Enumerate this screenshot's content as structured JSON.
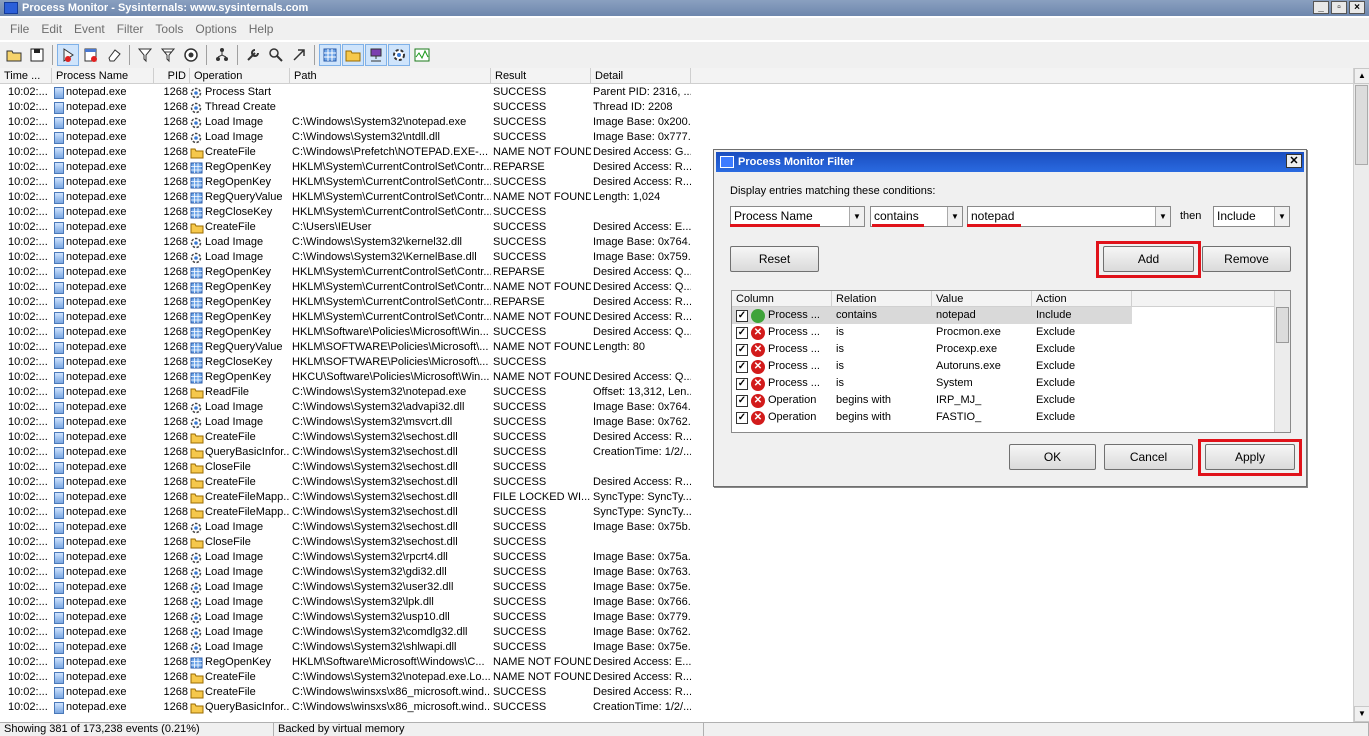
{
  "window": {
    "title": "Process Monitor - Sysinternals: www.sysinternals.com",
    "min_label": "_",
    "restore_label": "▫",
    "close_label": "×"
  },
  "menu": [
    "File",
    "Edit",
    "Event",
    "Filter",
    "Tools",
    "Options",
    "Help"
  ],
  "toolbar": {
    "icons": [
      "open-icon",
      "save-icon",
      "capture-icon",
      "autoscroll-icon",
      "clear-icon",
      "filter-icon",
      "highlight-icon",
      "include-process-icon",
      "process-tree-icon",
      "properties-icon",
      "find-icon",
      "jump-icon",
      "registry-activity-icon",
      "file-activity-icon",
      "network-activity-icon",
      "process-activity-icon",
      "profiling-activity-icon"
    ]
  },
  "columns": {
    "time": "Time ...",
    "process": "Process Name",
    "pid": "PID",
    "operation": "Operation",
    "path": "Path",
    "result": "Result",
    "detail": "Detail"
  },
  "events": [
    {
      "time": "10:02:...",
      "proc": "notepad.exe",
      "pid": "1268",
      "op": "Process Start",
      "kind": "proc",
      "path": "",
      "result": "SUCCESS",
      "detail": "Parent PID: 2316, ..."
    },
    {
      "time": "10:02:...",
      "proc": "notepad.exe",
      "pid": "1268",
      "op": "Thread Create",
      "kind": "proc",
      "path": "",
      "result": "SUCCESS",
      "detail": "Thread ID: 2208"
    },
    {
      "time": "10:02:...",
      "proc": "notepad.exe",
      "pid": "1268",
      "op": "Load Image",
      "kind": "proc",
      "path": "C:\\Windows\\System32\\notepad.exe",
      "result": "SUCCESS",
      "detail": "Image Base: 0x200..."
    },
    {
      "time": "10:02:...",
      "proc": "notepad.exe",
      "pid": "1268",
      "op": "Load Image",
      "kind": "proc",
      "path": "C:\\Windows\\System32\\ntdll.dll",
      "result": "SUCCESS",
      "detail": "Image Base: 0x777..."
    },
    {
      "time": "10:02:...",
      "proc": "notepad.exe",
      "pid": "1268",
      "op": "CreateFile",
      "kind": "file",
      "path": "C:\\Windows\\Prefetch\\NOTEPAD.EXE-...",
      "result": "NAME NOT FOUND",
      "detail": "Desired Access: G..."
    },
    {
      "time": "10:02:...",
      "proc": "notepad.exe",
      "pid": "1268",
      "op": "RegOpenKey",
      "kind": "reg",
      "path": "HKLM\\System\\CurrentControlSet\\Contr...",
      "result": "REPARSE",
      "detail": "Desired Access: R..."
    },
    {
      "time": "10:02:...",
      "proc": "notepad.exe",
      "pid": "1268",
      "op": "RegOpenKey",
      "kind": "reg",
      "path": "HKLM\\System\\CurrentControlSet\\Contr...",
      "result": "SUCCESS",
      "detail": "Desired Access: R..."
    },
    {
      "time": "10:02:...",
      "proc": "notepad.exe",
      "pid": "1268",
      "op": "RegQueryValue",
      "kind": "reg",
      "path": "HKLM\\System\\CurrentControlSet\\Contr...",
      "result": "NAME NOT FOUND",
      "detail": "Length: 1,024"
    },
    {
      "time": "10:02:...",
      "proc": "notepad.exe",
      "pid": "1268",
      "op": "RegCloseKey",
      "kind": "reg",
      "path": "HKLM\\System\\CurrentControlSet\\Contr...",
      "result": "SUCCESS",
      "detail": ""
    },
    {
      "time": "10:02:...",
      "proc": "notepad.exe",
      "pid": "1268",
      "op": "CreateFile",
      "kind": "file",
      "path": "C:\\Users\\IEUser",
      "result": "SUCCESS",
      "detail": "Desired Access: E..."
    },
    {
      "time": "10:02:...",
      "proc": "notepad.exe",
      "pid": "1268",
      "op": "Load Image",
      "kind": "proc",
      "path": "C:\\Windows\\System32\\kernel32.dll",
      "result": "SUCCESS",
      "detail": "Image Base: 0x764..."
    },
    {
      "time": "10:02:...",
      "proc": "notepad.exe",
      "pid": "1268",
      "op": "Load Image",
      "kind": "proc",
      "path": "C:\\Windows\\System32\\KernelBase.dll",
      "result": "SUCCESS",
      "detail": "Image Base: 0x759..."
    },
    {
      "time": "10:02:...",
      "proc": "notepad.exe",
      "pid": "1268",
      "op": "RegOpenKey",
      "kind": "reg",
      "path": "HKLM\\System\\CurrentControlSet\\Contr...",
      "result": "REPARSE",
      "detail": "Desired Access: Q..."
    },
    {
      "time": "10:02:...",
      "proc": "notepad.exe",
      "pid": "1268",
      "op": "RegOpenKey",
      "kind": "reg",
      "path": "HKLM\\System\\CurrentControlSet\\Contr...",
      "result": "NAME NOT FOUND",
      "detail": "Desired Access: Q..."
    },
    {
      "time": "10:02:...",
      "proc": "notepad.exe",
      "pid": "1268",
      "op": "RegOpenKey",
      "kind": "reg",
      "path": "HKLM\\System\\CurrentControlSet\\Contr...",
      "result": "REPARSE",
      "detail": "Desired Access: R..."
    },
    {
      "time": "10:02:...",
      "proc": "notepad.exe",
      "pid": "1268",
      "op": "RegOpenKey",
      "kind": "reg",
      "path": "HKLM\\System\\CurrentControlSet\\Contr...",
      "result": "NAME NOT FOUND",
      "detail": "Desired Access: R..."
    },
    {
      "time": "10:02:...",
      "proc": "notepad.exe",
      "pid": "1268",
      "op": "RegOpenKey",
      "kind": "reg",
      "path": "HKLM\\Software\\Policies\\Microsoft\\Win...",
      "result": "SUCCESS",
      "detail": "Desired Access: Q..."
    },
    {
      "time": "10:02:...",
      "proc": "notepad.exe",
      "pid": "1268",
      "op": "RegQueryValue",
      "kind": "reg",
      "path": "HKLM\\SOFTWARE\\Policies\\Microsoft\\...",
      "result": "NAME NOT FOUND",
      "detail": "Length: 80"
    },
    {
      "time": "10:02:...",
      "proc": "notepad.exe",
      "pid": "1268",
      "op": "RegCloseKey",
      "kind": "reg",
      "path": "HKLM\\SOFTWARE\\Policies\\Microsoft\\...",
      "result": "SUCCESS",
      "detail": ""
    },
    {
      "time": "10:02:...",
      "proc": "notepad.exe",
      "pid": "1268",
      "op": "RegOpenKey",
      "kind": "reg",
      "path": "HKCU\\Software\\Policies\\Microsoft\\Win...",
      "result": "NAME NOT FOUND",
      "detail": "Desired Access: Q..."
    },
    {
      "time": "10:02:...",
      "proc": "notepad.exe",
      "pid": "1268",
      "op": "ReadFile",
      "kind": "file",
      "path": "C:\\Windows\\System32\\notepad.exe",
      "result": "SUCCESS",
      "detail": "Offset: 13,312, Len..."
    },
    {
      "time": "10:02:...",
      "proc": "notepad.exe",
      "pid": "1268",
      "op": "Load Image",
      "kind": "proc",
      "path": "C:\\Windows\\System32\\advapi32.dll",
      "result": "SUCCESS",
      "detail": "Image Base: 0x764..."
    },
    {
      "time": "10:02:...",
      "proc": "notepad.exe",
      "pid": "1268",
      "op": "Load Image",
      "kind": "proc",
      "path": "C:\\Windows\\System32\\msvcrt.dll",
      "result": "SUCCESS",
      "detail": "Image Base: 0x762..."
    },
    {
      "time": "10:02:...",
      "proc": "notepad.exe",
      "pid": "1268",
      "op": "CreateFile",
      "kind": "file",
      "path": "C:\\Windows\\System32\\sechost.dll",
      "result": "SUCCESS",
      "detail": "Desired Access: R..."
    },
    {
      "time": "10:02:...",
      "proc": "notepad.exe",
      "pid": "1268",
      "op": "QueryBasicInfor...",
      "kind": "file",
      "path": "C:\\Windows\\System32\\sechost.dll",
      "result": "SUCCESS",
      "detail": "CreationTime: 1/2/..."
    },
    {
      "time": "10:02:...",
      "proc": "notepad.exe",
      "pid": "1268",
      "op": "CloseFile",
      "kind": "file",
      "path": "C:\\Windows\\System32\\sechost.dll",
      "result": "SUCCESS",
      "detail": ""
    },
    {
      "time": "10:02:...",
      "proc": "notepad.exe",
      "pid": "1268",
      "op": "CreateFile",
      "kind": "file",
      "path": "C:\\Windows\\System32\\sechost.dll",
      "result": "SUCCESS",
      "detail": "Desired Access: R..."
    },
    {
      "time": "10:02:...",
      "proc": "notepad.exe",
      "pid": "1268",
      "op": "CreateFileMapp...",
      "kind": "file",
      "path": "C:\\Windows\\System32\\sechost.dll",
      "result": "FILE LOCKED WI...",
      "detail": "SyncType: SyncTy..."
    },
    {
      "time": "10:02:...",
      "proc": "notepad.exe",
      "pid": "1268",
      "op": "CreateFileMapp...",
      "kind": "file",
      "path": "C:\\Windows\\System32\\sechost.dll",
      "result": "SUCCESS",
      "detail": "SyncType: SyncTy..."
    },
    {
      "time": "10:02:...",
      "proc": "notepad.exe",
      "pid": "1268",
      "op": "Load Image",
      "kind": "proc",
      "path": "C:\\Windows\\System32\\sechost.dll",
      "result": "SUCCESS",
      "detail": "Image Base: 0x75b..."
    },
    {
      "time": "10:02:...",
      "proc": "notepad.exe",
      "pid": "1268",
      "op": "CloseFile",
      "kind": "file",
      "path": "C:\\Windows\\System32\\sechost.dll",
      "result": "SUCCESS",
      "detail": ""
    },
    {
      "time": "10:02:...",
      "proc": "notepad.exe",
      "pid": "1268",
      "op": "Load Image",
      "kind": "proc",
      "path": "C:\\Windows\\System32\\rpcrt4.dll",
      "result": "SUCCESS",
      "detail": "Image Base: 0x75a..."
    },
    {
      "time": "10:02:...",
      "proc": "notepad.exe",
      "pid": "1268",
      "op": "Load Image",
      "kind": "proc",
      "path": "C:\\Windows\\System32\\gdi32.dll",
      "result": "SUCCESS",
      "detail": "Image Base: 0x763..."
    },
    {
      "time": "10:02:...",
      "proc": "notepad.exe",
      "pid": "1268",
      "op": "Load Image",
      "kind": "proc",
      "path": "C:\\Windows\\System32\\user32.dll",
      "result": "SUCCESS",
      "detail": "Image Base: 0x75e..."
    },
    {
      "time": "10:02:...",
      "proc": "notepad.exe",
      "pid": "1268",
      "op": "Load Image",
      "kind": "proc",
      "path": "C:\\Windows\\System32\\lpk.dll",
      "result": "SUCCESS",
      "detail": "Image Base: 0x766..."
    },
    {
      "time": "10:02:...",
      "proc": "notepad.exe",
      "pid": "1268",
      "op": "Load Image",
      "kind": "proc",
      "path": "C:\\Windows\\System32\\usp10.dll",
      "result": "SUCCESS",
      "detail": "Image Base: 0x779..."
    },
    {
      "time": "10:02:...",
      "proc": "notepad.exe",
      "pid": "1268",
      "op": "Load Image",
      "kind": "proc",
      "path": "C:\\Windows\\System32\\comdlg32.dll",
      "result": "SUCCESS",
      "detail": "Image Base: 0x762..."
    },
    {
      "time": "10:02:...",
      "proc": "notepad.exe",
      "pid": "1268",
      "op": "Load Image",
      "kind": "proc",
      "path": "C:\\Windows\\System32\\shlwapi.dll",
      "result": "SUCCESS",
      "detail": "Image Base: 0x75e..."
    },
    {
      "time": "10:02:...",
      "proc": "notepad.exe",
      "pid": "1268",
      "op": "RegOpenKey",
      "kind": "reg",
      "path": "HKLM\\Software\\Microsoft\\Windows\\C...",
      "result": "NAME NOT FOUND",
      "detail": "Desired Access: E..."
    },
    {
      "time": "10:02:...",
      "proc": "notepad.exe",
      "pid": "1268",
      "op": "CreateFile",
      "kind": "file",
      "path": "C:\\Windows\\System32\\notepad.exe.Lo...",
      "result": "NAME NOT FOUND",
      "detail": "Desired Access: R..."
    },
    {
      "time": "10:02:...",
      "proc": "notepad.exe",
      "pid": "1268",
      "op": "CreateFile",
      "kind": "file",
      "path": "C:\\Windows\\winsxs\\x86_microsoft.wind...",
      "result": "SUCCESS",
      "detail": "Desired Access: R..."
    },
    {
      "time": "10:02:...",
      "proc": "notepad.exe",
      "pid": "1268",
      "op": "QueryBasicInfor...",
      "kind": "file",
      "path": "C:\\Windows\\winsxs\\x86_microsoft.wind...",
      "result": "SUCCESS",
      "detail": "CreationTime: 1/2/..."
    }
  ],
  "status": {
    "events": "Showing 381 of 173,238 events (0.21%)",
    "memory": "Backed by virtual memory"
  },
  "filter_dialog": {
    "title": "Process Monitor Filter",
    "prompt": "Display entries matching these conditions:",
    "column_value": "Process Name",
    "relation_value": "contains",
    "value_value": "notepad",
    "then_label": "then",
    "action_value": "Include",
    "reset_label": "Reset",
    "add_label": "Add",
    "remove_label": "Remove",
    "ok_label": "OK",
    "cancel_label": "Cancel",
    "apply_label": "Apply",
    "headers": {
      "column": "Column",
      "relation": "Relation",
      "value": "Value",
      "action": "Action"
    },
    "rules": [
      {
        "column": "Process ...",
        "relation": "contains",
        "value": "notepad",
        "action": "Include",
        "type": "include"
      },
      {
        "column": "Process ...",
        "relation": "is",
        "value": "Procmon.exe",
        "action": "Exclude",
        "type": "exclude"
      },
      {
        "column": "Process ...",
        "relation": "is",
        "value": "Procexp.exe",
        "action": "Exclude",
        "type": "exclude"
      },
      {
        "column": "Process ...",
        "relation": "is",
        "value": "Autoruns.exe",
        "action": "Exclude",
        "type": "exclude"
      },
      {
        "column": "Process ...",
        "relation": "is",
        "value": "System",
        "action": "Exclude",
        "type": "exclude"
      },
      {
        "column": "Operation",
        "relation": "begins with",
        "value": "IRP_MJ_",
        "action": "Exclude",
        "type": "exclude"
      },
      {
        "column": "Operation",
        "relation": "begins with",
        "value": "FASTIO_",
        "action": "Exclude",
        "type": "exclude"
      }
    ],
    "highlight_color": "#e0121a"
  }
}
